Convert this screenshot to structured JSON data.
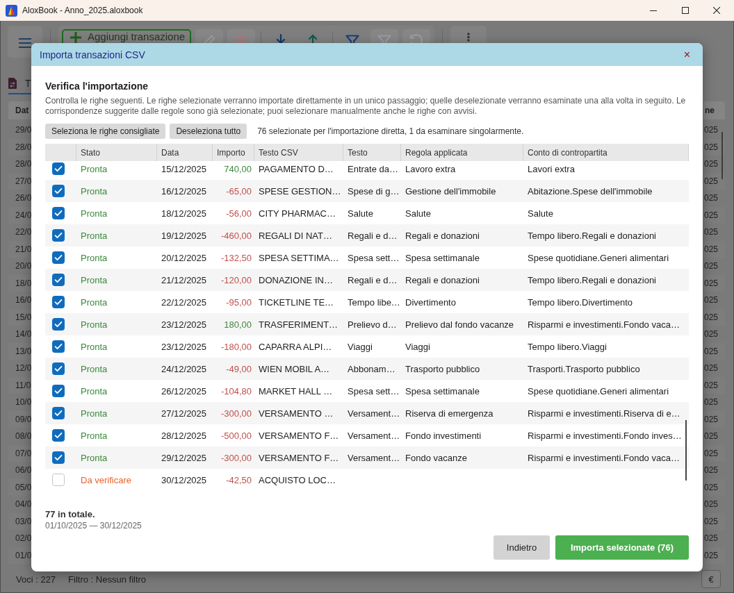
{
  "window": {
    "title": "AloxBook - Anno_2025.aloxbook"
  },
  "toolbar": {
    "add_button": "Aggiungi transazione",
    "groups": [
      [
        {
          "kind": "edit",
          "disabled": true
        },
        {
          "kind": "delete",
          "disabled": true
        }
      ],
      [
        {
          "kind": "download",
          "disabled": false
        },
        {
          "kind": "upload",
          "disabled": false
        }
      ],
      [
        {
          "kind": "filter",
          "disabled": false
        },
        {
          "kind": "filter",
          "disabled": true
        },
        {
          "kind": "undo",
          "disabled": true
        }
      ]
    ]
  },
  "tabs": [
    {
      "label": "T",
      "selected": true
    }
  ],
  "table": {
    "columns": [
      "Dat",
      "ne"
    ],
    "rows": [
      [
        "29/0",
        "025"
      ],
      [
        "28/0",
        "025"
      ],
      [
        "28/0",
        "025"
      ],
      [
        "27/0",
        "025"
      ],
      [
        "26/0",
        "025"
      ],
      [
        "24/0",
        "025"
      ],
      [
        "22/0",
        "025"
      ],
      [
        "21/0",
        "025"
      ],
      [
        "20/0",
        "025"
      ],
      [
        "18/0",
        "025"
      ],
      [
        "16/0",
        "025"
      ],
      [
        "15/0",
        "025"
      ],
      [
        "14/0",
        "025"
      ],
      [
        "13/0",
        "025"
      ],
      [
        "12/0",
        "025"
      ],
      [
        "11/0",
        "025"
      ],
      [
        "10/0",
        "025"
      ],
      [
        "09/0",
        "025"
      ],
      [
        "08/0",
        "025"
      ],
      [
        "07/0",
        "025"
      ],
      [
        "06/0",
        "025"
      ],
      [
        "05/0",
        "025"
      ],
      [
        "04/0",
        "025"
      ],
      [
        "03/0",
        "025"
      ],
      [
        "02/0",
        "025"
      ],
      [
        "01/0",
        "025"
      ]
    ]
  },
  "status_bar": {
    "entries": "Voci : 227",
    "filter": "Filtro : Nessun filtro",
    "currency_button": "€"
  },
  "dialog": {
    "title": "Importa transazioni CSV",
    "close": "×",
    "heading": "Verifica l'importazione",
    "description": "Controlla le righe seguenti. Le righe selezionate verranno importate direttamente in un unico passaggio; quelle deselezionate verranno esaminate una alla volta in seguito. Le corrispondenze suggerite dalle regole sono già selezionate; puoi selezionare manualmente anche le righe con avvisi.",
    "actions": [
      "Seleziona le righe consigliate",
      "Deseleziona tutto"
    ],
    "summary": "76 selezionate per l'importazione diretta, 1 da esaminare singolarmente.",
    "table": {
      "columns": [
        "Stato",
        "Data",
        "Importo",
        "Testo CSV",
        "Testo",
        "Regola applicata",
        "Conto di contropartita"
      ],
      "rows": [
        {
          "checked": true,
          "status": "Pronta",
          "warning": false,
          "date": "15/12/2025",
          "amount": "740,00",
          "income": true,
          "csv_text": "PAGAMENTO D…",
          "text": "Entrate da…",
          "rule": "Lavoro extra",
          "account": "Lavori extra"
        },
        {
          "checked": true,
          "status": "Pronta",
          "warning": false,
          "date": "16/12/2025",
          "amount": "-65,00",
          "income": false,
          "csv_text": "SPESE GESTION…",
          "text": "Spese di g…",
          "rule": "Gestione dell'immobile",
          "account": "Abitazione.Spese dell'immobile"
        },
        {
          "checked": true,
          "status": "Pronta",
          "warning": false,
          "date": "18/12/2025",
          "amount": "-56,00",
          "income": false,
          "csv_text": "CITY PHARMAC…",
          "text": "Salute",
          "rule": "Salute",
          "account": "Salute"
        },
        {
          "checked": true,
          "status": "Pronta",
          "warning": false,
          "date": "19/12/2025",
          "amount": "-460,00",
          "income": false,
          "csv_text": "REGALI DI NAT…",
          "text": "Regali e d…",
          "rule": "Regali e donazioni",
          "account": "Tempo libero.Regali e donazioni"
        },
        {
          "checked": true,
          "status": "Pronta",
          "warning": false,
          "date": "20/12/2025",
          "amount": "-132,50",
          "income": false,
          "csv_text": "SPESA SETTIMA…",
          "text": "Spesa sett…",
          "rule": "Spesa settimanale",
          "account": "Spese quotidiane.Generi alimentari"
        },
        {
          "checked": true,
          "status": "Pronta",
          "warning": false,
          "date": "21/12/2025",
          "amount": "-120,00",
          "income": false,
          "csv_text": "DONAZIONE IN…",
          "text": "Regali e d…",
          "rule": "Regali e donazioni",
          "account": "Tempo libero.Regali e donazioni"
        },
        {
          "checked": true,
          "status": "Pronta",
          "warning": false,
          "date": "22/12/2025",
          "amount": "-95,00",
          "income": false,
          "csv_text": "TICKETLINE TE…",
          "text": "Tempo libe…",
          "rule": "Divertimento",
          "account": "Tempo libero.Divertimento"
        },
        {
          "checked": true,
          "status": "Pronta",
          "warning": false,
          "date": "23/12/2025",
          "amount": "180,00",
          "income": true,
          "csv_text": "TRASFERIMENT…",
          "text": "Prelievo d…",
          "rule": "Prelievo dal fondo vacanze",
          "account": "Risparmi e investimenti.Fondo vaca…"
        },
        {
          "checked": true,
          "status": "Pronta",
          "warning": false,
          "date": "23/12/2025",
          "amount": "-180,00",
          "income": false,
          "csv_text": "CAPARRA ALPI…",
          "text": "Viaggi",
          "rule": "Viaggi",
          "account": "Tempo libero.Viaggi"
        },
        {
          "checked": true,
          "status": "Pronta",
          "warning": false,
          "date": "24/12/2025",
          "amount": "-49,00",
          "income": false,
          "csv_text": "WIEN MOBIL A…",
          "text": "Abbonam…",
          "rule": "Trasporto pubblico",
          "account": "Trasporti.Trasporto pubblico"
        },
        {
          "checked": true,
          "status": "Pronta",
          "warning": false,
          "date": "26/12/2025",
          "amount": "-104,80",
          "income": false,
          "csv_text": "MARKET HALL …",
          "text": "Spesa sett…",
          "rule": "Spesa settimanale",
          "account": "Spese quotidiane.Generi alimentari"
        },
        {
          "checked": true,
          "status": "Pronta",
          "warning": false,
          "date": "27/12/2025",
          "amount": "-300,00",
          "income": false,
          "csv_text": "VERSAMENTO …",
          "text": "Versament…",
          "rule": "Riserva di emergenza",
          "account": "Risparmi e investimenti.Riserva di e…"
        },
        {
          "checked": true,
          "status": "Pronta",
          "warning": false,
          "date": "28/12/2025",
          "amount": "-500,00",
          "income": false,
          "csv_text": "VERSAMENTO F…",
          "text": "Versament…",
          "rule": "Fondo investimenti",
          "account": "Risparmi e investimenti.Fondo inves…"
        },
        {
          "checked": true,
          "status": "Pronta",
          "warning": false,
          "date": "29/12/2025",
          "amount": "-300,00",
          "income": false,
          "csv_text": "VERSAMENTO F…",
          "text": "Versament…",
          "rule": "Fondo vacanze",
          "account": "Risparmi e investimenti.Fondo vaca…"
        },
        {
          "checked": false,
          "status": "Da verificare",
          "warning": true,
          "date": "30/12/2025",
          "amount": "-42,50",
          "income": false,
          "csv_text": "ACQUISTO LOC…"
        }
      ]
    },
    "total": "77 in totale.",
    "period": "01/10/2025 — 30/12/2025",
    "buttons": [
      {
        "label": "Indietro",
        "kind": "secondary"
      },
      {
        "label": "Importa selezionate (76)",
        "kind": "primary"
      }
    ]
  }
}
